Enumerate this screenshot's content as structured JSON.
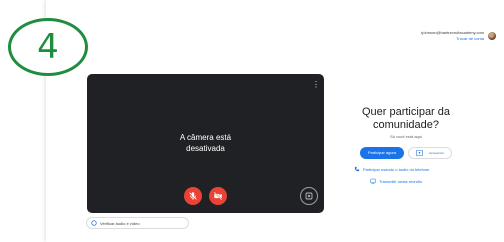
{
  "step_badge": "4",
  "account": {
    "email": "rjohnson@hantrecruitacademy.com",
    "switch_label": "Trocar de conta"
  },
  "preview": {
    "camera_off_line1": "A câmera está",
    "camera_off_line2": "desativada",
    "menu_glyph": "⋮"
  },
  "check_audio_label": "Verificar áudio e vídeo",
  "join": {
    "title_line1": "Quer participar da",
    "title_line2": "comunidade?",
    "subtitle": "Só você está aqui",
    "join_now_label": "Participar agora",
    "present_label": "Apresentar",
    "phone_link": "Participar usando o áudio do telefone",
    "companion_link": "Transmitir nesta reunião"
  },
  "colors": {
    "accent": "#1a73e8",
    "badge": "#1e8e3e",
    "danger": "#ea4335",
    "video_bg": "#202124"
  }
}
